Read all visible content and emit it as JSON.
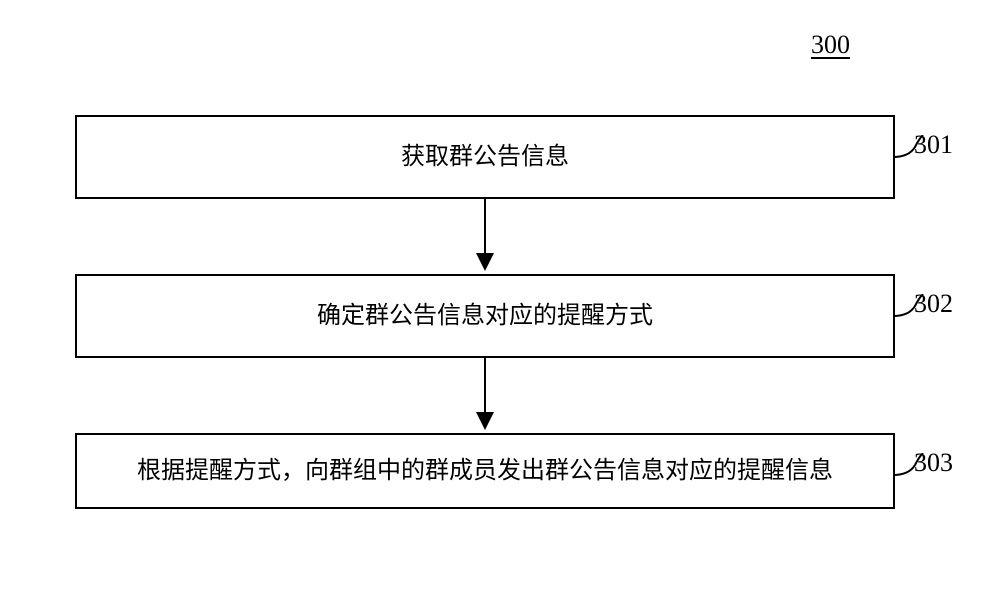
{
  "diagram": {
    "label": "300",
    "steps": [
      {
        "number": "301",
        "text": "获取群公告信息"
      },
      {
        "number": "302",
        "text": "确定群公告信息对应的提醒方式"
      },
      {
        "number": "303",
        "text": "根据提醒方式，向群组中的群成员发出群公告信息对应的提醒信息"
      }
    ]
  },
  "chart_data": {
    "type": "flowchart",
    "title": "300",
    "nodes": [
      {
        "id": "301",
        "label": "获取群公告信息"
      },
      {
        "id": "302",
        "label": "确定群公告信息对应的提醒方式"
      },
      {
        "id": "303",
        "label": "根据提醒方式，向群组中的群成员发出群公告信息对应的提醒信息"
      }
    ],
    "edges": [
      {
        "from": "301",
        "to": "302"
      },
      {
        "from": "302",
        "to": "303"
      }
    ]
  }
}
